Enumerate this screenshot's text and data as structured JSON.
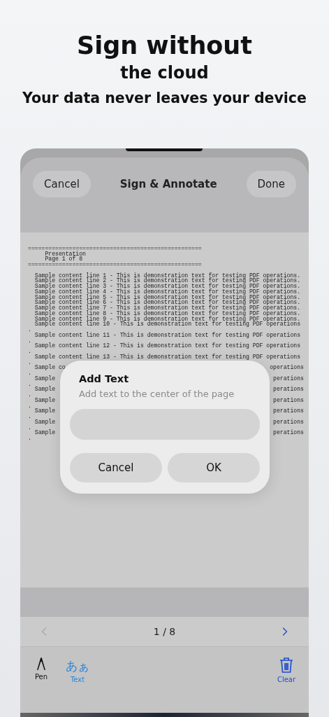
{
  "promo": {
    "title": "Sign without",
    "subtitle": "the cloud",
    "tagline": "Your data never leaves your device"
  },
  "nav": {
    "cancel": "Cancel",
    "title": "Sign & Annotate",
    "done": "Done"
  },
  "document": {
    "rows": [
      {
        "kind": "rule",
        "text": "==================================================="
      },
      {
        "kind": "heading",
        "text": "Presentation"
      },
      {
        "kind": "heading",
        "text": "Page 1 of 8"
      },
      {
        "kind": "rule",
        "text": "==================================================="
      },
      {
        "kind": "blank"
      },
      {
        "kind": "line",
        "text": "Sample content line 1 - This is demonstration text for testing PDF operations."
      },
      {
        "kind": "line",
        "text": "Sample content line 2 - This is demonstration text for testing PDF operations."
      },
      {
        "kind": "line",
        "text": "Sample content line 3 - This is demonstration text for testing PDF operations."
      },
      {
        "kind": "line",
        "text": "Sample content line 4 - This is demonstration text for testing PDF operations."
      },
      {
        "kind": "line",
        "text": "Sample content line 5 - This is demonstration text for testing PDF operations."
      },
      {
        "kind": "line",
        "text": "Sample content line 6 - This is demonstration text for testing PDF operations."
      },
      {
        "kind": "line",
        "text": "Sample content line 7 - This is demonstration text for testing PDF operations."
      },
      {
        "kind": "line",
        "text": "Sample content line 8 - This is demonstration text for testing PDF operations."
      },
      {
        "kind": "line",
        "text": "Sample content line 9 - This is demonstration text for testing PDF operations."
      },
      {
        "kind": "line",
        "text": "Sample content line 10 - This is demonstration text for testing PDF operations"
      },
      {
        "kind": "dot",
        "text": "."
      },
      {
        "kind": "line",
        "text": "Sample content line 11 - This is demonstration text for testing PDF operations"
      },
      {
        "kind": "dot",
        "text": "."
      },
      {
        "kind": "line",
        "text": "Sample content line 12 - This is demonstration text for testing PDF operations"
      },
      {
        "kind": "dot",
        "text": "."
      },
      {
        "kind": "line",
        "text": "Sample content line 13 - This is demonstration text for testing PDF operations"
      },
      {
        "kind": "dot",
        "text": "."
      },
      {
        "kind": "partial",
        "left": "Sample co",
        "right": "operations"
      },
      {
        "kind": "dot",
        "text": "."
      },
      {
        "kind": "partial",
        "left": "Sample",
        "right": "perations"
      },
      {
        "kind": "dot",
        "text": "."
      },
      {
        "kind": "partial",
        "left": "Sample",
        "right": "perations"
      },
      {
        "kind": "dot",
        "text": "."
      },
      {
        "kind": "partial",
        "left": "Sample",
        "right": "perations"
      },
      {
        "kind": "dot",
        "text": "."
      },
      {
        "kind": "partial",
        "left": "Sample",
        "right": "perations"
      },
      {
        "kind": "dot",
        "text": "."
      },
      {
        "kind": "partial",
        "left": "Sample",
        "right": "perations"
      },
      {
        "kind": "dot",
        "text": "."
      },
      {
        "kind": "partial",
        "left": "Sample",
        "right": "perations"
      },
      {
        "kind": "dot",
        "text": "."
      }
    ]
  },
  "dialog": {
    "title": "Add Text",
    "message": "Add text to the center of the page",
    "buttons": [
      "Cancel",
      "OK"
    ]
  },
  "pager": {
    "label": "1 / 8",
    "prev_enabled": false,
    "next_enabled": true
  },
  "tools": [
    {
      "kind": "pen",
      "label": "Pen",
      "selected": false
    },
    {
      "kind": "text",
      "glyph": "あぁ",
      "label": "Text",
      "selected": true
    },
    {
      "kind": "clear",
      "label": "Clear"
    }
  ]
}
